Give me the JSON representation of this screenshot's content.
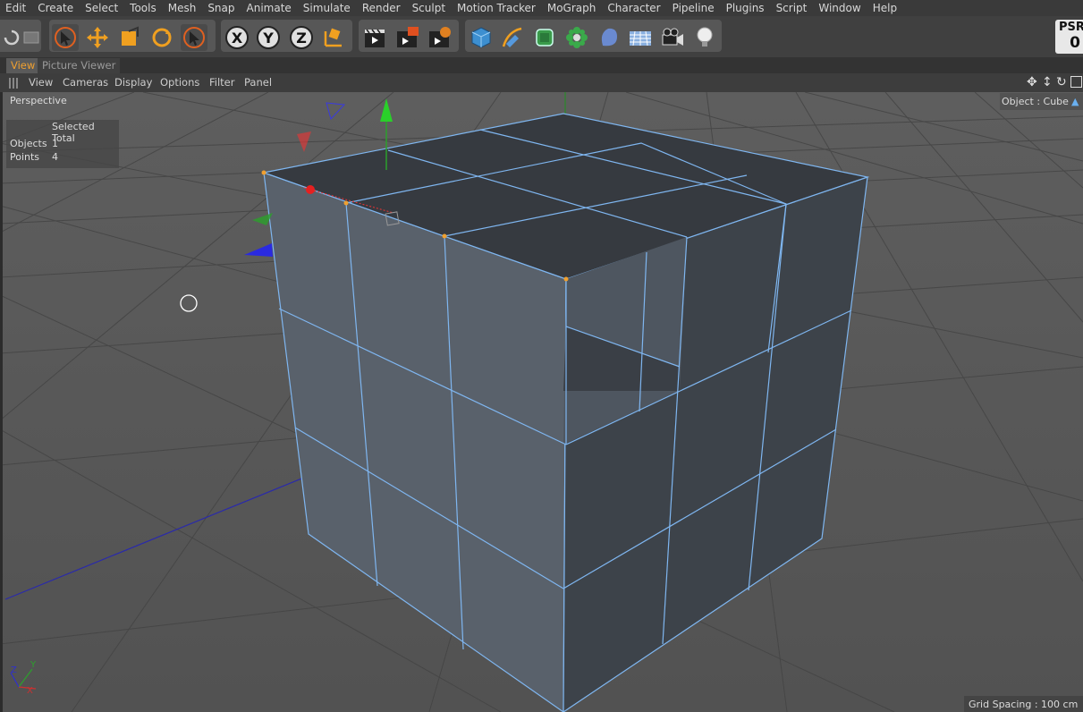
{
  "menu": [
    "Edit",
    "Create",
    "Select",
    "Tools",
    "Mesh",
    "Snap",
    "Animate",
    "Simulate",
    "Render",
    "Sculpt",
    "Motion Tracker",
    "MoGraph",
    "Character",
    "Pipeline",
    "Plugins",
    "Script",
    "Window",
    "Help"
  ],
  "toolbar": {
    "axis_x": "X",
    "axis_y": "Y",
    "axis_z": "Z",
    "psr_label": "PSR",
    "psr_value": "0"
  },
  "tabs": {
    "view": "View",
    "picture_viewer": "Picture Viewer"
  },
  "view_menu": [
    "View",
    "Cameras",
    "Display",
    "Options",
    "Filter",
    "Panel"
  ],
  "viewport": {
    "camera": "Perspective",
    "object_label": "Object : Cube",
    "hud": {
      "header": "Selected Total",
      "rows": [
        {
          "label": "Objects",
          "value": "1"
        },
        {
          "label": "Points",
          "value": "4"
        }
      ]
    },
    "grid_spacing": "Grid Spacing : 100 cm",
    "axis_y": "Y",
    "axis_x": "X",
    "axis_z": "Z"
  }
}
